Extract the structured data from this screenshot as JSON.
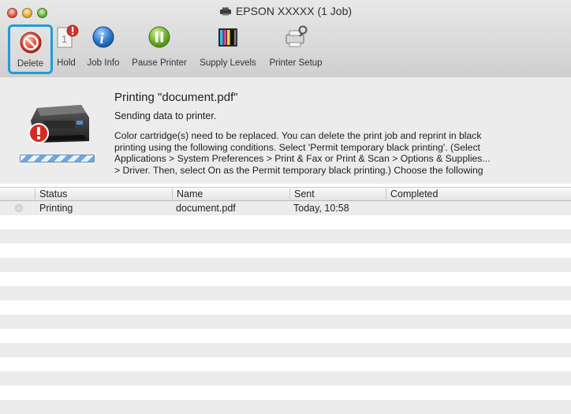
{
  "window": {
    "title": "EPSON XXXXX (1 Job)"
  },
  "toolbar": {
    "items": [
      {
        "label": "Delete",
        "icon": "delete-icon"
      },
      {
        "label": "Hold",
        "icon": "hold-icon"
      },
      {
        "label": "Job Info",
        "icon": "info-icon"
      },
      {
        "label": "Pause Printer",
        "icon": "pause-icon"
      },
      {
        "label": "Supply Levels",
        "icon": "supply-levels-icon"
      },
      {
        "label": "Printer Setup",
        "icon": "printer-setup-icon"
      }
    ],
    "selected": "Delete",
    "accent": "#1c9ed8"
  },
  "job": {
    "heading": "Printing \"document.pdf\"",
    "status": "Sending data to printer.",
    "message_lines": [
      "Color cartridge(s) need to be replaced. You can delete the print job and reprint in black",
      "printing using the following conditions. Select 'Permit temporary black printing'. (Select",
      "Applications > System Preferences > Print & Fax or Print & Scan > Options & Supplies...",
      "> Driver. Then, select On as the Permit temporary black printing.) Choose the following"
    ]
  },
  "table": {
    "columns": [
      "Status",
      "Name",
      "Sent",
      "Completed"
    ],
    "rows": [
      {
        "status": "Printing",
        "name": "document.pdf",
        "sent": "Today, 10:58",
        "completed": ""
      }
    ]
  }
}
